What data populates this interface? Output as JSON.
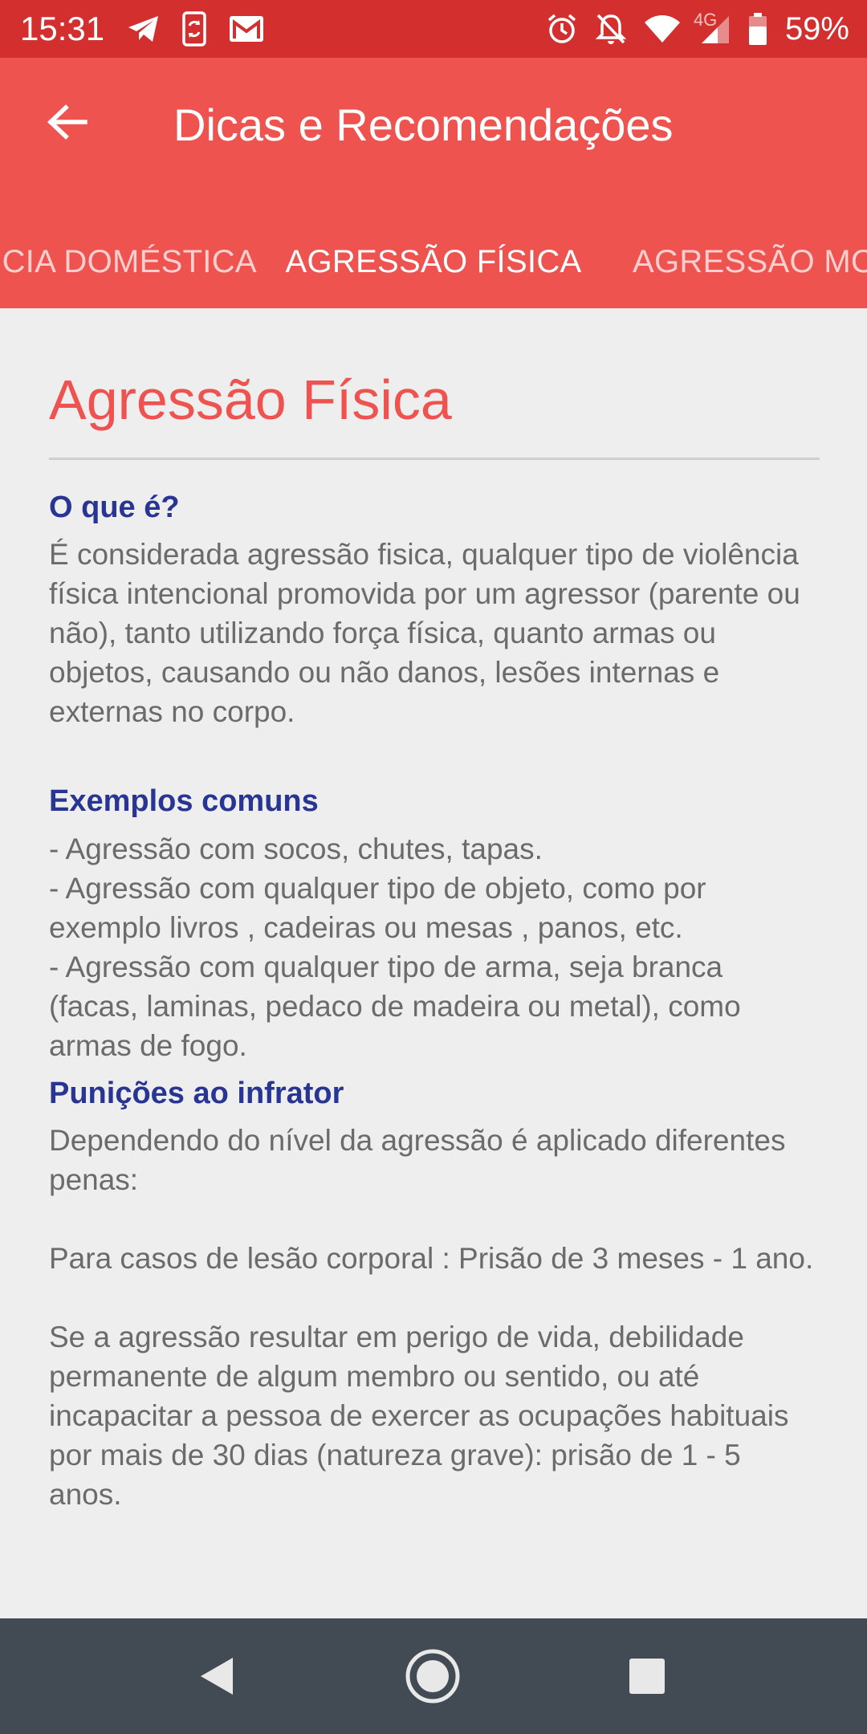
{
  "status_bar": {
    "time": "15:31",
    "battery_percent": "59%",
    "network_type": "4G",
    "left_icons": [
      "telegram-icon",
      "phone-sync-icon",
      "gmail-icon"
    ],
    "right_icons": [
      "alarm-icon",
      "notifications-off-icon",
      "wifi-icon",
      "signal-icon",
      "battery-icon"
    ]
  },
  "app_bar": {
    "title": "Dicas e Recomendações",
    "back_icon": "arrow-left-icon",
    "color": "#ef5350"
  },
  "tabs": [
    {
      "label": "VIOLÊNCIA DOMÉSTICA",
      "active": false
    },
    {
      "label": "AGRESSÃO FÍSICA",
      "active": true
    },
    {
      "label": "AGRESSÃO MORAL",
      "active": false
    }
  ],
  "tab_indicator_color": "#283593",
  "article": {
    "title": "Agressão Física",
    "sections": [
      {
        "heading": "O que é?",
        "body": "É considerada agressão fisica, qualquer tipo de violência física intencional promovida por um agressor (parente ou não), tanto utilizando força física, quanto armas ou objetos, causando ou não danos, lesões internas e externas no corpo."
      },
      {
        "heading": "Exemplos comuns",
        "body": "- Agressão com socos, chutes, tapas.\n- Agressão com qualquer tipo de objeto, como por exemplo livros , cadeiras ou mesas , panos, etc.\n- Agressão com qualquer tipo de arma, seja branca (facas, laminas, pedaco de madeira ou metal), como armas de fogo."
      },
      {
        "heading": "Punições ao infrator",
        "body": "Dependendo do nível da agressão é aplicado diferentes penas:\n\nPara casos de lesão corporal : Prisão de 3 meses - 1 ano.\n\nSe a agressão resultar em perigo de vida, debilidade permanente de algum membro ou sentido, ou até incapacitar a pessoa de exercer as ocupações habituais por mais de 30 dias (natureza grave): prisão de 1 - 5 anos."
      }
    ]
  },
  "nav_bar": {
    "icons": [
      "nav-back-icon",
      "nav-home-icon",
      "nav-recents-icon"
    ]
  }
}
